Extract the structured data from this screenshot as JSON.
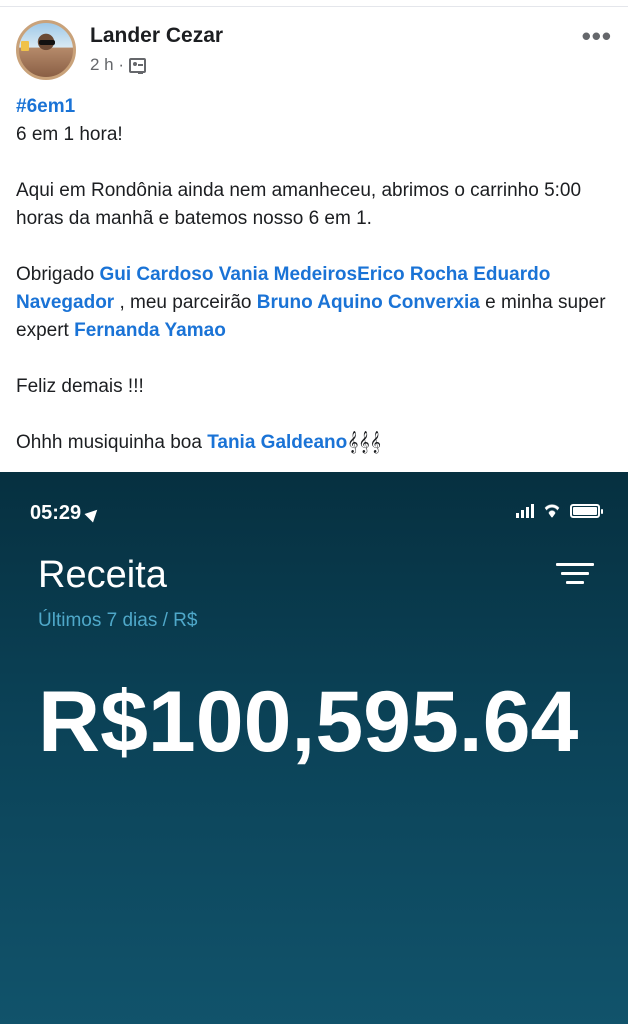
{
  "post": {
    "author": "Lander Cezar",
    "time": "2 h ·",
    "more": "•••",
    "hashtag": "#6em1",
    "line1": "6 em 1 hora!",
    "para2": "Aqui em Rondônia ainda nem amanheceu, abrimos o carrinho 5:00 horas da manhã  e batemos nosso 6 em 1.",
    "thanks_prefix": "Obrigado ",
    "mention_1": "Gui Cardoso",
    "mention_2": "Vania Medeiros",
    "mention_3": "Erico Rocha",
    "mention_4": "Eduardo Navegador",
    "thanks_mid": " , meu parceirão ",
    "mention_5": "Bruno Aquino",
    "mention_6": "Converxia",
    "thanks_mid2": " e minha super expert ",
    "mention_7": "Fernanda Yamao",
    "happy": "Feliz demais !!!",
    "music_prefix": "Ohhh musiquinha boa ",
    "mention_8": "Tania Galdeano",
    "music_emoji": "𝄞𝄞𝄞"
  },
  "screenshot": {
    "time": "05:29",
    "title": "Receita",
    "subtitle": "Últimos 7 dias / R$",
    "amount": "R$100,595.64"
  }
}
